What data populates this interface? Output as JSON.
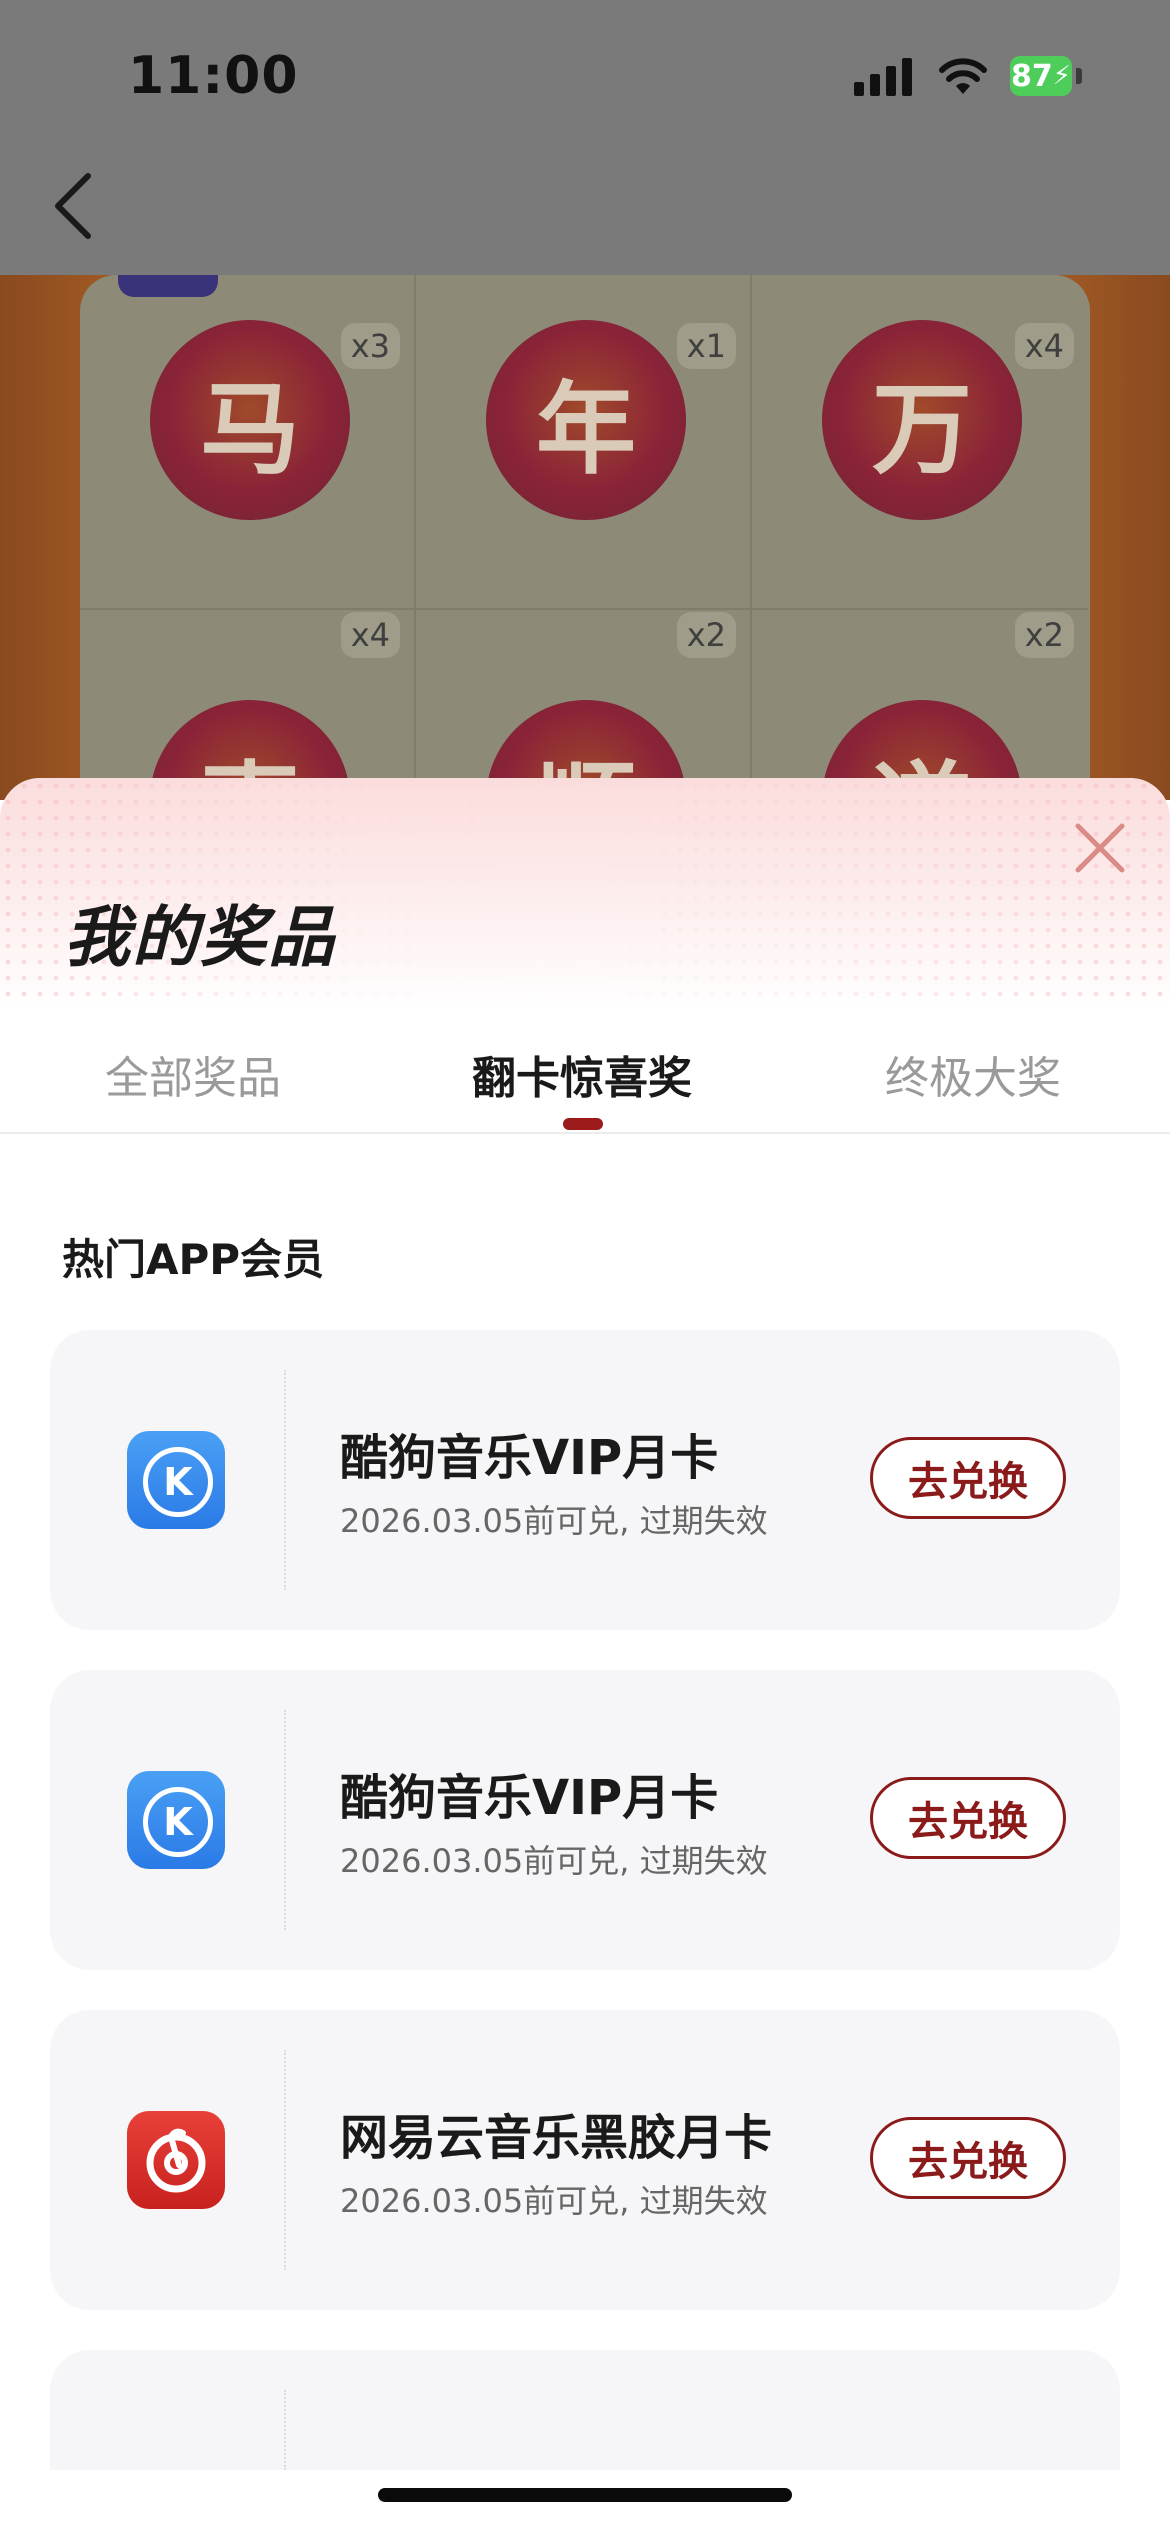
{
  "status_bar": {
    "time": "11:00",
    "battery": "87"
  },
  "background": {
    "tiles": [
      {
        "char": "马",
        "count": "x3"
      },
      {
        "char": "年",
        "count": "x1"
      },
      {
        "char": "万",
        "count": "x4"
      },
      {
        "char": "事",
        "count": "x4"
      },
      {
        "char": "顺",
        "count": "x2"
      },
      {
        "char": "遂",
        "count": "x2"
      }
    ]
  },
  "sheet": {
    "title": "我的奖品",
    "tabs": [
      {
        "label": "全部奖品",
        "active": false
      },
      {
        "label": "翻卡惊喜奖",
        "active": true
      },
      {
        "label": "终极大奖",
        "active": false
      }
    ],
    "section_title": "热门APP会员",
    "prizes": [
      {
        "icon": "kugou-music-icon",
        "name": "酷狗音乐VIP月卡",
        "note": "2026.03.05前可兑, 过期失效",
        "button": "去兑换"
      },
      {
        "icon": "kugou-music-icon",
        "name": "酷狗音乐VIP月卡",
        "note": "2026.03.05前可兑, 过期失效",
        "button": "去兑换"
      },
      {
        "icon": "netease-cloud-music-icon",
        "name": "网易云音乐黑胶月卡",
        "note": "2026.03.05前可兑, 过期失效",
        "button": "去兑换"
      }
    ]
  },
  "colors": {
    "accent": "#8b1a1a",
    "tab_indicator": "#9b1b1b",
    "card_bg": "#f6f6f8"
  }
}
